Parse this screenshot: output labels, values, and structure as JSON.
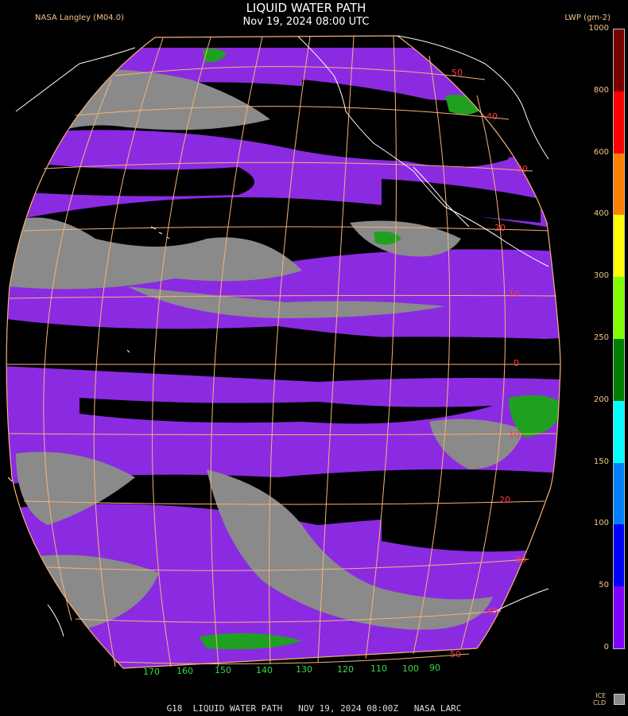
{
  "header": {
    "title": "LIQUID WATER PATH",
    "subtitle": "Nov 19, 2024 08:00 UTC",
    "credit": "NASA Langley (M04.0)",
    "colorbar_title": "LWP (gm-2)"
  },
  "colorbar": {
    "ticks": [
      "1000",
      "800",
      "600",
      "400",
      "300",
      "250",
      "200",
      "150",
      "100",
      "50",
      "0"
    ],
    "colors": [
      "#7a0000",
      "#ff0000",
      "#ff8000",
      "#ffff00",
      "#80ff00",
      "#008000",
      "#00ffff",
      "#0080ff",
      "#0000ff",
      "#8000ff"
    ],
    "ice_label": "ICE\nCLD",
    "ice_color": "#8a8a8a"
  },
  "map": {
    "disk_color": "#000000",
    "cloud_color": "#8a2be2",
    "ice_color": "#8a8a8a",
    "high_lwp_color": "#20a020",
    "grid_color": "#f5b27a",
    "coast_color": "#ffffff",
    "lat_labels": [
      "50",
      "40",
      "30",
      "20",
      "10",
      "0",
      "10",
      "20",
      "30",
      "40",
      "50"
    ],
    "lon_labels": [
      "170",
      "160",
      "150",
      "140",
      "130",
      "120",
      "110",
      "100",
      "90"
    ]
  },
  "footer": {
    "text": "G18  LIQUID WATER PATH   NOV 19, 2024 08:00Z   NASA LARC"
  }
}
